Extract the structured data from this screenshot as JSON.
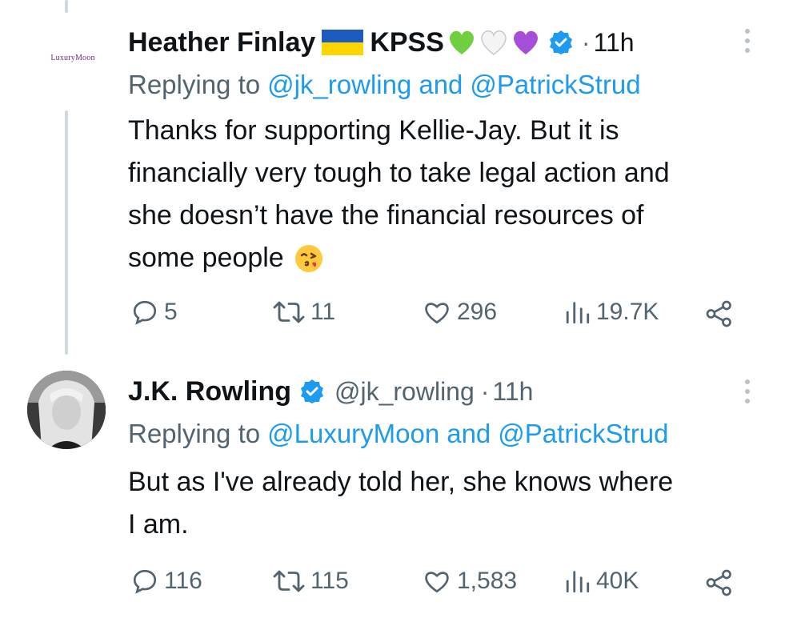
{
  "tweets": [
    {
      "display_name": "Heather Finlay",
      "name_suffix": "KPSS",
      "dot": "·",
      "time": "11h",
      "avatar_logo": "LuxuryMoon",
      "replying_prefix": "Replying to",
      "replying_to_1": "@jk_rowling",
      "and": "and",
      "replying_to_2": "@PatrickStrud",
      "body_lines": [
        "Thanks for supporting Kellie-Jay. But  it is",
        "financially very tough to take legal action and",
        "she doesn’t have the financial resources of",
        "some people"
      ],
      "stats": {
        "replies": "5",
        "retweets": "11",
        "likes": "296",
        "views": "19.7K"
      }
    },
    {
      "display_name": "J.K. Rowling",
      "handle": "@jk_rowling",
      "dot": "·",
      "time": "11h",
      "replying_prefix": "Replying to",
      "replying_to_1": "@LuxuryMoon",
      "and": "and",
      "replying_to_2": "@PatrickStrud",
      "body_lines": [
        "But as I've already told her, she knows where",
        "I am."
      ],
      "stats": {
        "replies": "116",
        "retweets": "115",
        "likes": "1,583",
        "views": "40K"
      }
    }
  ],
  "colors": {
    "text": "#0f1419",
    "muted": "#536471",
    "link": "#1d9bf0",
    "verified": "#1d9bf0",
    "thread_line": "#cfd9de"
  },
  "icons": [
    "reply-icon",
    "retweet-icon",
    "like-icon",
    "views-icon",
    "share-icon",
    "more-icon",
    "verified-badge-icon",
    "ukraine-flag-icon",
    "green-heart-icon",
    "white-heart-icon",
    "purple-heart-icon",
    "kissing-face-icon"
  ]
}
